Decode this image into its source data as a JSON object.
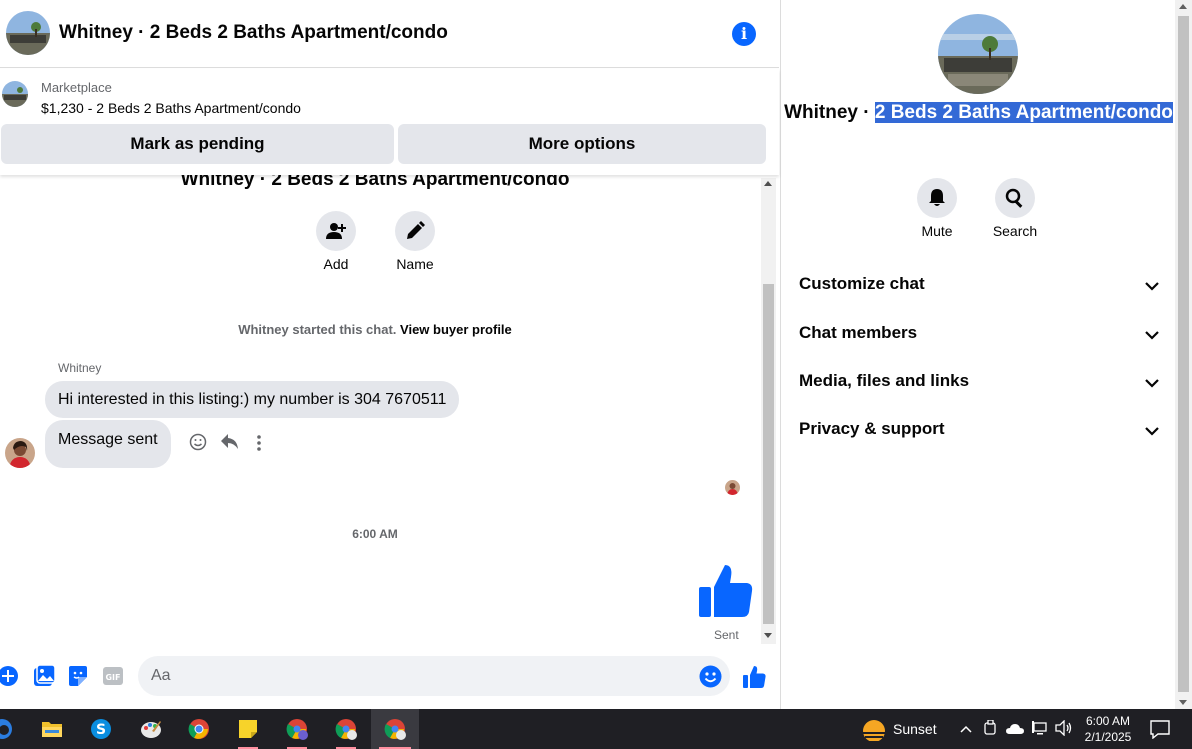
{
  "header": {
    "title": "Whitney · 2 Beds 2 Baths Apartment/condo"
  },
  "marketplace": {
    "label": "Marketplace",
    "listing": "$1,230 - 2 Beds 2 Baths Apartment/condo",
    "mark_pending": "Mark as pending",
    "more_options": "More options"
  },
  "thread": {
    "title": "Whitney · 2 Beds 2 Baths Apartment/condo",
    "actions": [
      {
        "label": "Add",
        "icon": "add-person-icon"
      },
      {
        "label": "Name",
        "icon": "pencil-icon"
      }
    ],
    "started_text": "Whitney started this chat.",
    "buyer_profile_link": "View buyer profile",
    "sender_name": "Whitney",
    "messages": [
      {
        "text": "Hi interested in this listing:) my number is 304 7670511"
      },
      {
        "text": "Message sent"
      }
    ],
    "timestamp": "6:00 AM",
    "sent_status": "Sent"
  },
  "composer": {
    "placeholder": "Aa"
  },
  "sidebar": {
    "title_plain": "Whitney · ",
    "title_highlighted": "2 Beds 2 Baths Apartment/condo",
    "actions": [
      {
        "label": "Mute",
        "icon": "bell-icon"
      },
      {
        "label": "Search",
        "icon": "search-icon"
      }
    ],
    "sections": [
      {
        "label": "Customize chat"
      },
      {
        "label": "Chat members"
      },
      {
        "label": "Media, files and links"
      },
      {
        "label": "Privacy & support"
      }
    ]
  },
  "taskbar": {
    "weather": "Sunset",
    "time": "6:00 AM",
    "date": "2/1/2025"
  },
  "colors": {
    "accent": "#0866ff",
    "bubble_gray": "#e4e6eb",
    "selection": "#3369d6",
    "taskbar": "#1f1f24"
  }
}
